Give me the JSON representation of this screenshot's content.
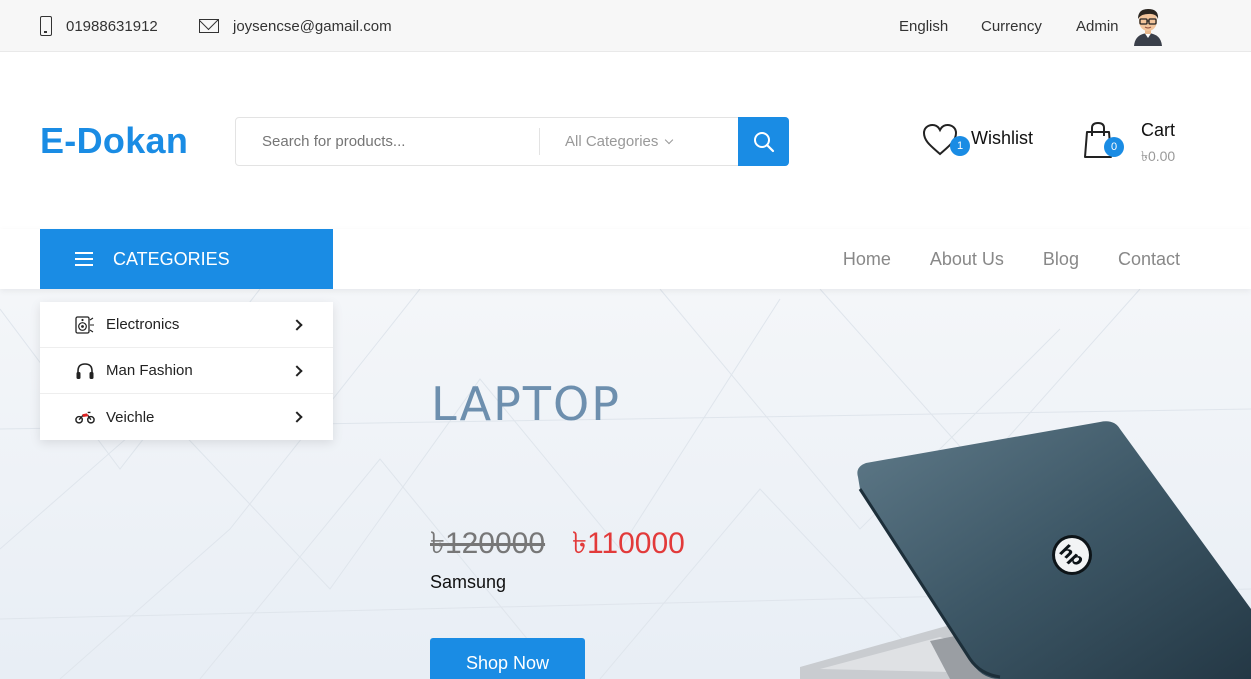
{
  "topbar": {
    "phone": "01988631912",
    "email": "joysencse@gamail.com",
    "language": "English",
    "currency": "Currency",
    "user": "Admin"
  },
  "header": {
    "logo": "E-Dokan",
    "search_placeholder": "Search for products...",
    "category_select": "All Categories",
    "wishlist_label": "Wishlist",
    "wishlist_count": "1",
    "cart_label": "Cart",
    "cart_count": "0",
    "cart_total": "৳0.00"
  },
  "nav": {
    "categories_label": "CATEGORIES",
    "links": [
      "Home",
      "About Us",
      "Blog",
      "Contact"
    ]
  },
  "categories": [
    {
      "label": "Electronics",
      "icon": "speaker-icon"
    },
    {
      "label": "Man Fashion",
      "icon": "headphones-icon"
    },
    {
      "label": "Veichle",
      "icon": "motorbike-icon"
    }
  ],
  "hero": {
    "title": "LAPTOP",
    "price_old": "৳120000",
    "price_new": "৳110000",
    "brand": "Samsung",
    "cta": "Shop Now"
  },
  "colors": {
    "accent": "#1a8ce4",
    "sale": "#e23a3a",
    "hero_title": "#6d8fae"
  }
}
